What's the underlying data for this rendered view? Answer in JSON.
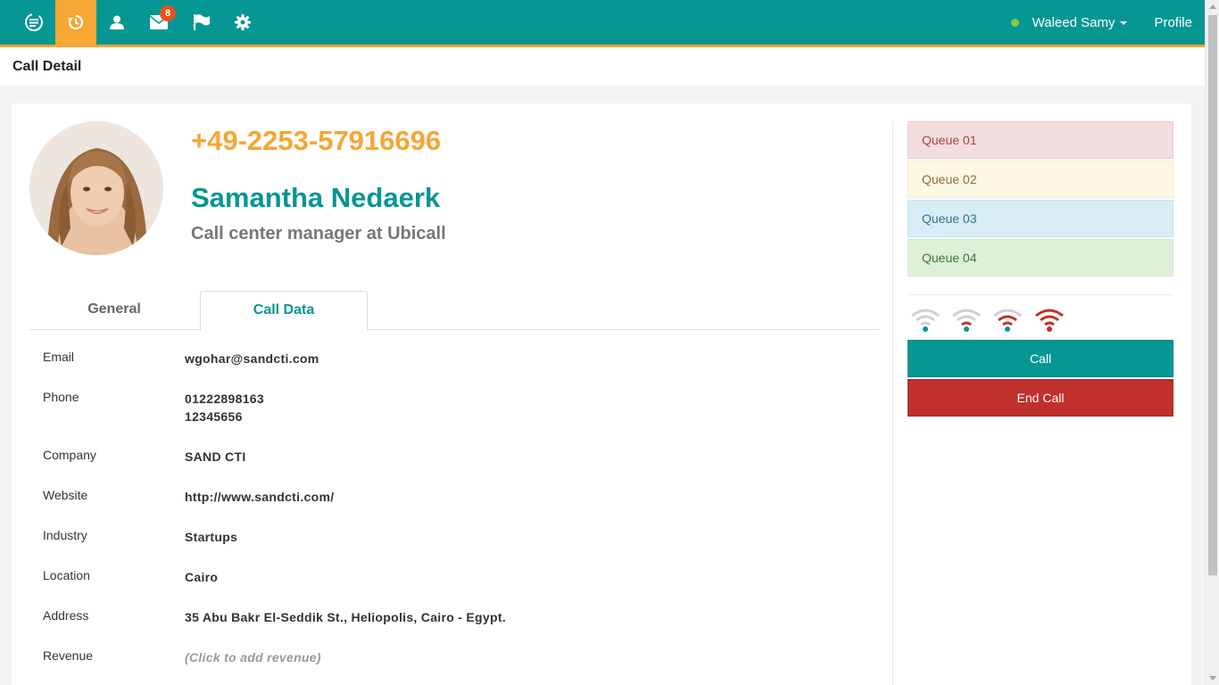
{
  "nav": {
    "icons": [
      "ubicall-logo-icon",
      "history-icon",
      "contact-icon",
      "mail-icon",
      "flag-icon",
      "gear-icon"
    ],
    "mail_badge": "8",
    "user_name": "Waleed Samy",
    "profile_label": "Profile",
    "status_color": "#8ec63f"
  },
  "page": {
    "title": "Call Detail"
  },
  "contact": {
    "phone": "+49-2253-57916696",
    "name": "Samantha Nedaerk",
    "role": "Call center manager at Ubicall"
  },
  "tabs": [
    {
      "label": "General",
      "active": false
    },
    {
      "label": "Call Data",
      "active": true
    }
  ],
  "fields": [
    {
      "label": "Email",
      "value": "wgohar@sandcti.com"
    },
    {
      "label": "Phone",
      "value": "01222898163",
      "value2": "12345656"
    },
    {
      "label": "Company",
      "value": "SAND CTI"
    },
    {
      "label": "Website",
      "value": "http://www.sandcti.com/"
    },
    {
      "label": "Industry",
      "value": "Startups"
    },
    {
      "label": "Location",
      "value": "Cairo"
    },
    {
      "label": "Address",
      "value": "35 Abu Bakr El-Seddik St., Heliopolis, Cairo - Egypt."
    },
    {
      "label": "Revenue",
      "value": "(Click to add revenue)"
    }
  ],
  "queues": [
    "Queue 01",
    "Queue 02",
    "Queue 03",
    "Queue 04"
  ],
  "signals": [
    {
      "icon": "wifi-signal-icon",
      "level": 0
    },
    {
      "icon": "wifi-signal-icon",
      "level": 1
    },
    {
      "icon": "wifi-signal-icon",
      "level": 2
    },
    {
      "icon": "wifi-signal-icon",
      "level": 3
    }
  ],
  "actions": {
    "call": "Call",
    "end_call": "End Call"
  },
  "colors": {
    "primary": "#069693",
    "accent": "#f6a634",
    "danger": "#c0302c"
  }
}
